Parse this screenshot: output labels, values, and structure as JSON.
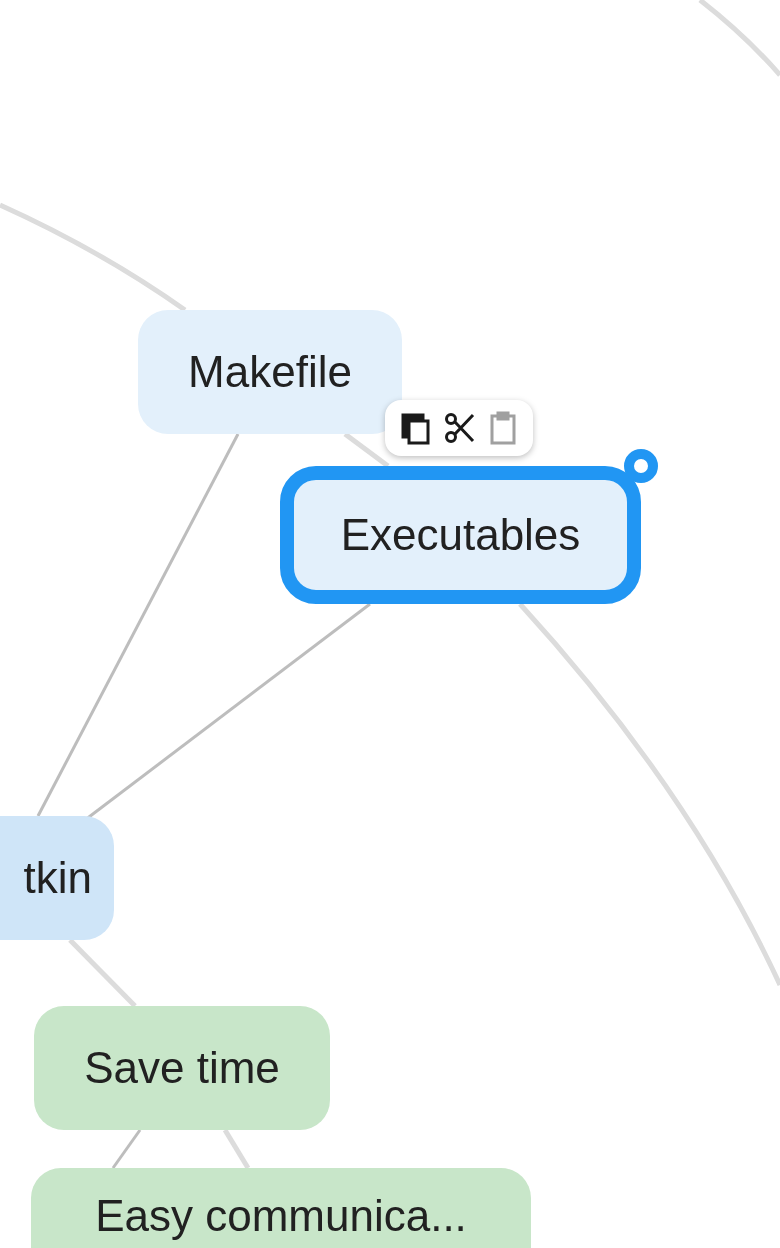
{
  "nodes": [
    {
      "label": "Makefile",
      "selected": false,
      "color": "#e3f0fb"
    },
    {
      "label": "Executables",
      "selected": true,
      "color": "#e3f0fb"
    },
    {
      "label": "tkin",
      "selected": false,
      "color": "#cfe5f8"
    },
    {
      "label": "Save time",
      "selected": false,
      "color": "#c8e6c9"
    },
    {
      "label": "Easy communica...",
      "selected": false,
      "color": "#c8e6c9"
    }
  ],
  "toolbar": {
    "buttons": [
      {
        "kind": "copy",
        "disabled": false
      },
      {
        "kind": "cut",
        "disabled": false
      },
      {
        "kind": "paste",
        "disabled": true
      }
    ]
  }
}
